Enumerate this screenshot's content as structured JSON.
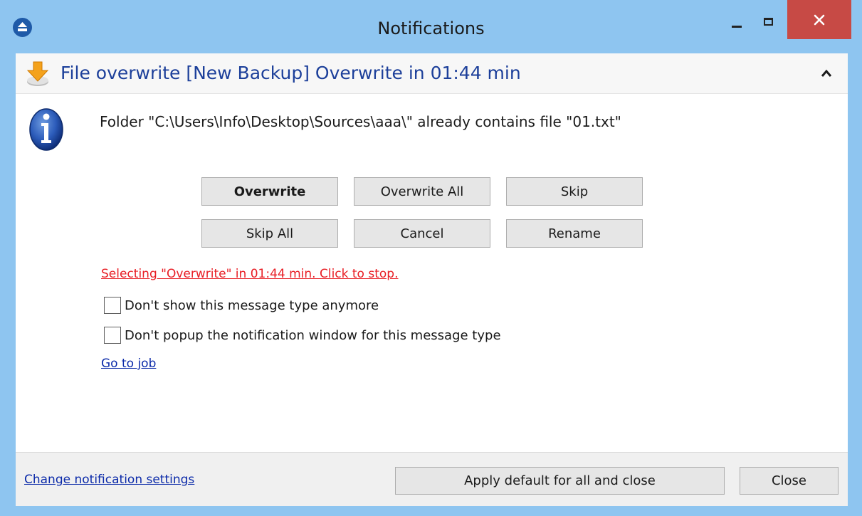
{
  "window": {
    "title": "Notifications"
  },
  "notification": {
    "header_title": "File overwrite [New Backup] Overwrite in 01:44 min",
    "message": "Folder \"C:\\Users\\Info\\Desktop\\Sources\\aaa\\\" already contains file \"01.txt\""
  },
  "actions": {
    "overwrite": "Overwrite",
    "overwrite_all": "Overwrite All",
    "skip": "Skip",
    "skip_all": "Skip All",
    "cancel": "Cancel",
    "rename": "Rename"
  },
  "auto_select": {
    "text": "Selecting \"Overwrite\" in 01:44 min. Click to stop."
  },
  "options": {
    "dont_show": {
      "label": "Don't show this message type anymore",
      "checked": false
    },
    "dont_popup": {
      "label": "Don't popup the notification window for this message type",
      "checked": false
    }
  },
  "links": {
    "go_to_job": "Go to job",
    "change_settings": "Change notification settings"
  },
  "footer": {
    "apply_default": "Apply default for all and close",
    "close": "Close"
  },
  "colors": {
    "titlebar": "#8ec5f0",
    "close_button": "#c74a45",
    "header_text": "#1c3f9a",
    "warning_text": "#e81e25",
    "link_text": "#0b2aa9"
  },
  "icons": {
    "app": "app-logo-icon",
    "download": "download-icon",
    "collapse": "chevron-up-icon",
    "info": "info-icon"
  }
}
